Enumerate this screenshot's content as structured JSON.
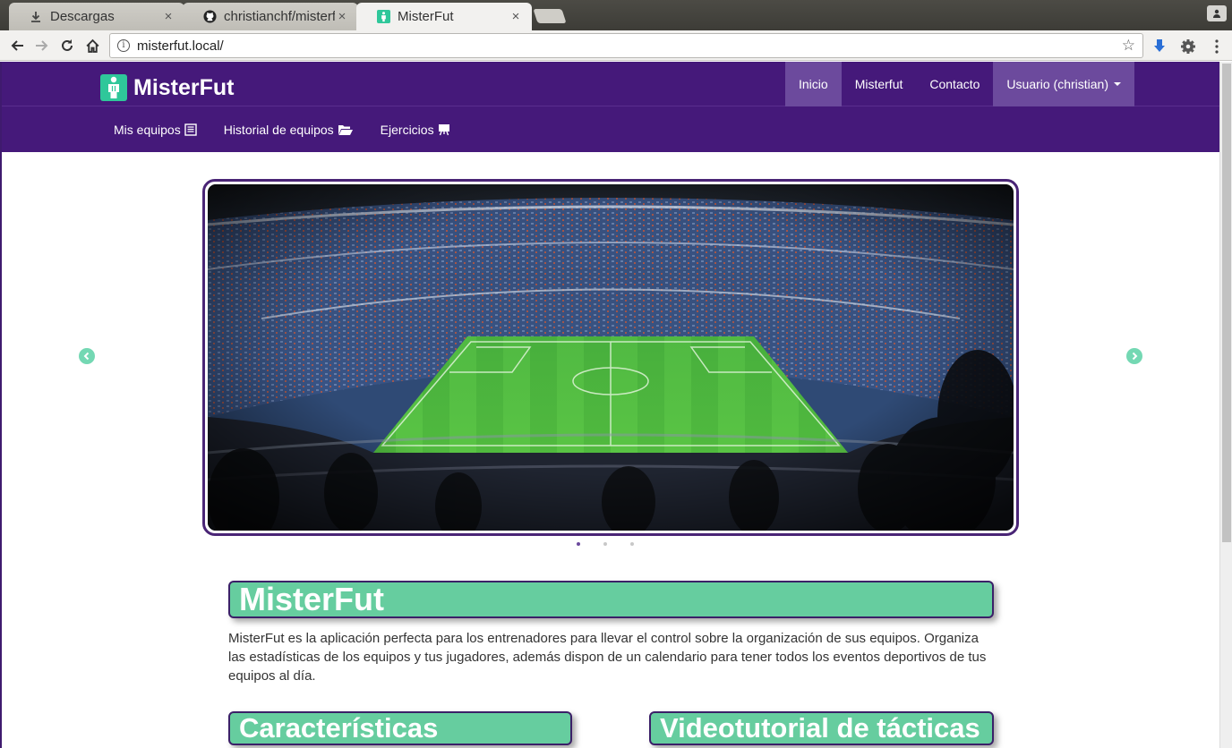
{
  "browser": {
    "tabs": [
      {
        "title": "Descargas",
        "icon": "download-icon",
        "active": false
      },
      {
        "title": "christianchf/misterfut",
        "icon": "github-icon",
        "active": false
      },
      {
        "title": "MisterFut",
        "icon": "misterfut-favicon",
        "active": true
      }
    ],
    "close_glyph": "×",
    "url": "misterfut.local/"
  },
  "navbar": {
    "brand": "MisterFut",
    "links": [
      "Inicio",
      "Misterfut",
      "Contacto"
    ],
    "user_menu": "Usuario (christian)",
    "sub_links": [
      "Mis equipos",
      "Historial de equipos",
      "Ejercicios"
    ],
    "colors": {
      "primary": "#45197a",
      "active": "#6c4a9d",
      "accent": "#66cd9f"
    }
  },
  "carousel": {
    "slide_count": 3,
    "active_slide": 1,
    "image": "football-stadium"
  },
  "content": {
    "title": "MisterFut",
    "intro": "MisterFut es la aplicación perfecta para los entrenadores para llevar el control sobre la organización de sus equipos. Organiza las estadísticas de los equipos y tus jugadores, además dispon de un calendario para tener todos los eventos deportivos de tus equipos al día.",
    "features_title": "Características",
    "video_title": "Videotutorial de tácticas"
  }
}
